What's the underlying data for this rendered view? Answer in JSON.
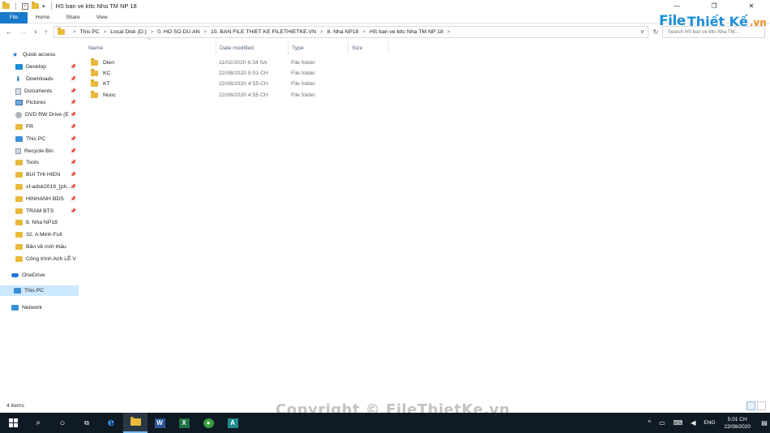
{
  "window": {
    "title": "HS ban ve kttc Nha TM NP 18",
    "controls": [
      "—",
      "❐",
      "✕"
    ]
  },
  "ribbon": {
    "tabs": [
      "File",
      "Home",
      "Share",
      "View"
    ]
  },
  "logo": {
    "part1": "File",
    "part2": "Thiết Kế",
    "part3": ".vn"
  },
  "address": {
    "crumbs": [
      "This PC",
      "Local Disk (D:)",
      "0. HO SO DU AN",
      "10. BAN FILE THIET KE FILETHIETKE.VN",
      "8. Nha NP18",
      "HS ban ve kttc Nha TM NP 18"
    ]
  },
  "search": {
    "placeholder": "Search HS ban ve kttc Nha TM..."
  },
  "columns": {
    "name": "Name",
    "date": "Date modified",
    "type": "Type",
    "size": "Size"
  },
  "files": [
    {
      "name": "Dien",
      "date": "11/02/2020 6:34 SA",
      "type": "File folder"
    },
    {
      "name": "KC",
      "date": "22/08/2020 5:01 CH",
      "type": "File folder"
    },
    {
      "name": "KT",
      "date": "22/08/2020 4:55 CH",
      "type": "File folder"
    },
    {
      "name": "Nuoc",
      "date": "22/08/2020 4:55 CH",
      "type": "File folder"
    }
  ],
  "navpane": {
    "quick_access": "Quick access",
    "items": [
      {
        "label": "Desktop",
        "icon": "desktop-icon"
      },
      {
        "label": "Downloads",
        "icon": "download-icon"
      },
      {
        "label": "Documents",
        "icon": "documents-icon"
      },
      {
        "label": "Pictures",
        "icon": "pictures-icon"
      },
      {
        "label": "DVD RW Drive (E",
        "icon": "dvd-icon"
      },
      {
        "label": "FR",
        "icon": "folder-icon"
      },
      {
        "label": "This PC",
        "icon": "pc-icon"
      },
      {
        "label": "Recycle Bin",
        "icon": "recycle-bin-icon"
      },
      {
        "label": "Tools",
        "icon": "folder-icon"
      },
      {
        "label": "BUI THI HIEN",
        "icon": "folder-icon"
      },
      {
        "label": "xf-adsk2019_[ph...",
        "icon": "folder-icon"
      },
      {
        "label": "HINHANH BDS",
        "icon": "folder-icon"
      },
      {
        "label": "TRAM BTS",
        "icon": "folder-icon"
      },
      {
        "label": "8. Nha NP18",
        "icon": "folder-icon"
      },
      {
        "label": "32. A Minh Full",
        "icon": "folder-icon"
      },
      {
        "label": "Bản vẽ mời thầu",
        "icon": "folder-icon"
      },
      {
        "label": "Công trình Anh LÊ V",
        "icon": "folder-icon"
      }
    ],
    "onedrive": "OneDrive",
    "this_pc": "This PC",
    "network": "Network"
  },
  "status": {
    "items": "4 items"
  },
  "watermark": "Copyright © FileThietKe.vn",
  "taskbar": {
    "language": "ENG",
    "time": "5:01 CH",
    "date": "22/08/2020"
  }
}
